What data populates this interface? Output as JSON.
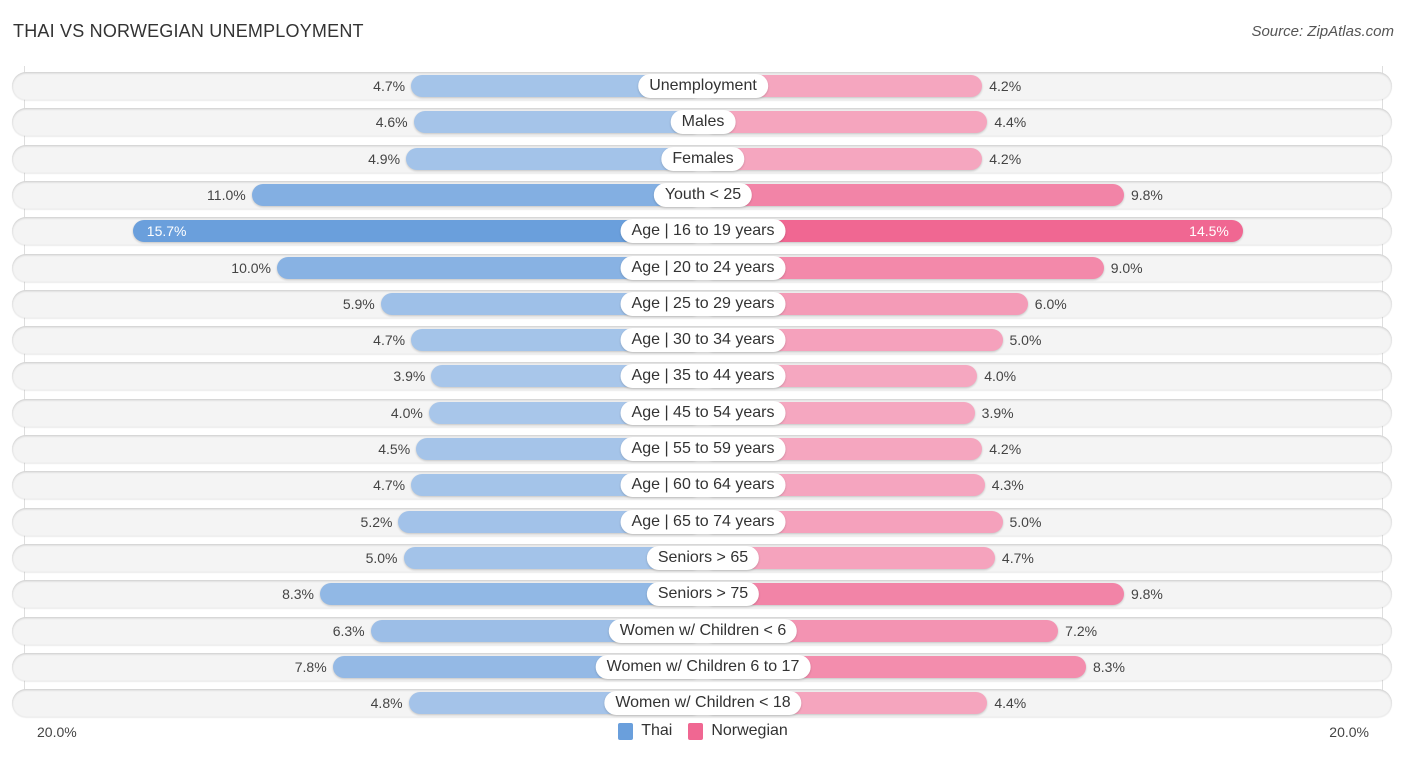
{
  "header": {
    "title": "THAI VS NORWEGIAN UNEMPLOYMENT",
    "source": "Source: ZipAtlas.com"
  },
  "colors": {
    "thai": "#6a9fdc",
    "thai_light": "#a8c6ea",
    "norwegian": "#f06792",
    "norwegian_light": "#f5a7c0"
  },
  "chart_data": {
    "type": "bar",
    "orientation": "horizontal-diverging",
    "title": "THAI VS NORWEGIAN UNEMPLOYMENT",
    "categories": [
      "Unemployment",
      "Males",
      "Females",
      "Youth < 25",
      "Age | 16 to 19 years",
      "Age | 20 to 24 years",
      "Age | 25 to 29 years",
      "Age | 30 to 34 years",
      "Age | 35 to 44 years",
      "Age | 45 to 54 years",
      "Age | 55 to 59 years",
      "Age | 60 to 64 years",
      "Age | 65 to 74 years",
      "Seniors > 65",
      "Seniors > 75",
      "Women w/ Children < 6",
      "Women w/ Children 6 to 17",
      "Women w/ Children < 18"
    ],
    "series": [
      {
        "name": "Thai",
        "values": [
          4.7,
          4.6,
          4.9,
          11.0,
          15.7,
          10.0,
          5.9,
          4.7,
          3.9,
          4.0,
          4.5,
          4.7,
          5.2,
          5.0,
          8.3,
          6.3,
          7.8,
          4.8
        ],
        "labels": [
          "4.7%",
          "4.6%",
          "4.9%",
          "11.0%",
          "15.7%",
          "10.0%",
          "5.9%",
          "4.7%",
          "3.9%",
          "4.0%",
          "4.5%",
          "4.7%",
          "5.2%",
          "5.0%",
          "8.3%",
          "6.3%",
          "7.8%",
          "4.8%"
        ]
      },
      {
        "name": "Norwegian",
        "values": [
          4.2,
          4.4,
          4.2,
          9.8,
          14.5,
          9.0,
          6.0,
          5.0,
          4.0,
          3.9,
          4.2,
          4.3,
          5.0,
          4.7,
          9.8,
          7.2,
          8.3,
          4.4
        ],
        "labels": [
          "4.2%",
          "4.4%",
          "4.2%",
          "9.8%",
          "14.5%",
          "9.0%",
          "6.0%",
          "5.0%",
          "4.0%",
          "3.9%",
          "4.2%",
          "4.3%",
          "5.0%",
          "4.7%",
          "9.8%",
          "7.2%",
          "8.3%",
          "4.4%"
        ]
      }
    ],
    "xlim": [
      20.0,
      20.0
    ],
    "axis_labels": {
      "left": "20.0%",
      "right": "20.0%"
    },
    "unit": "%",
    "legend": {
      "position": "bottom-center",
      "entries": [
        "Thai",
        "Norwegian"
      ]
    },
    "grid": false
  }
}
